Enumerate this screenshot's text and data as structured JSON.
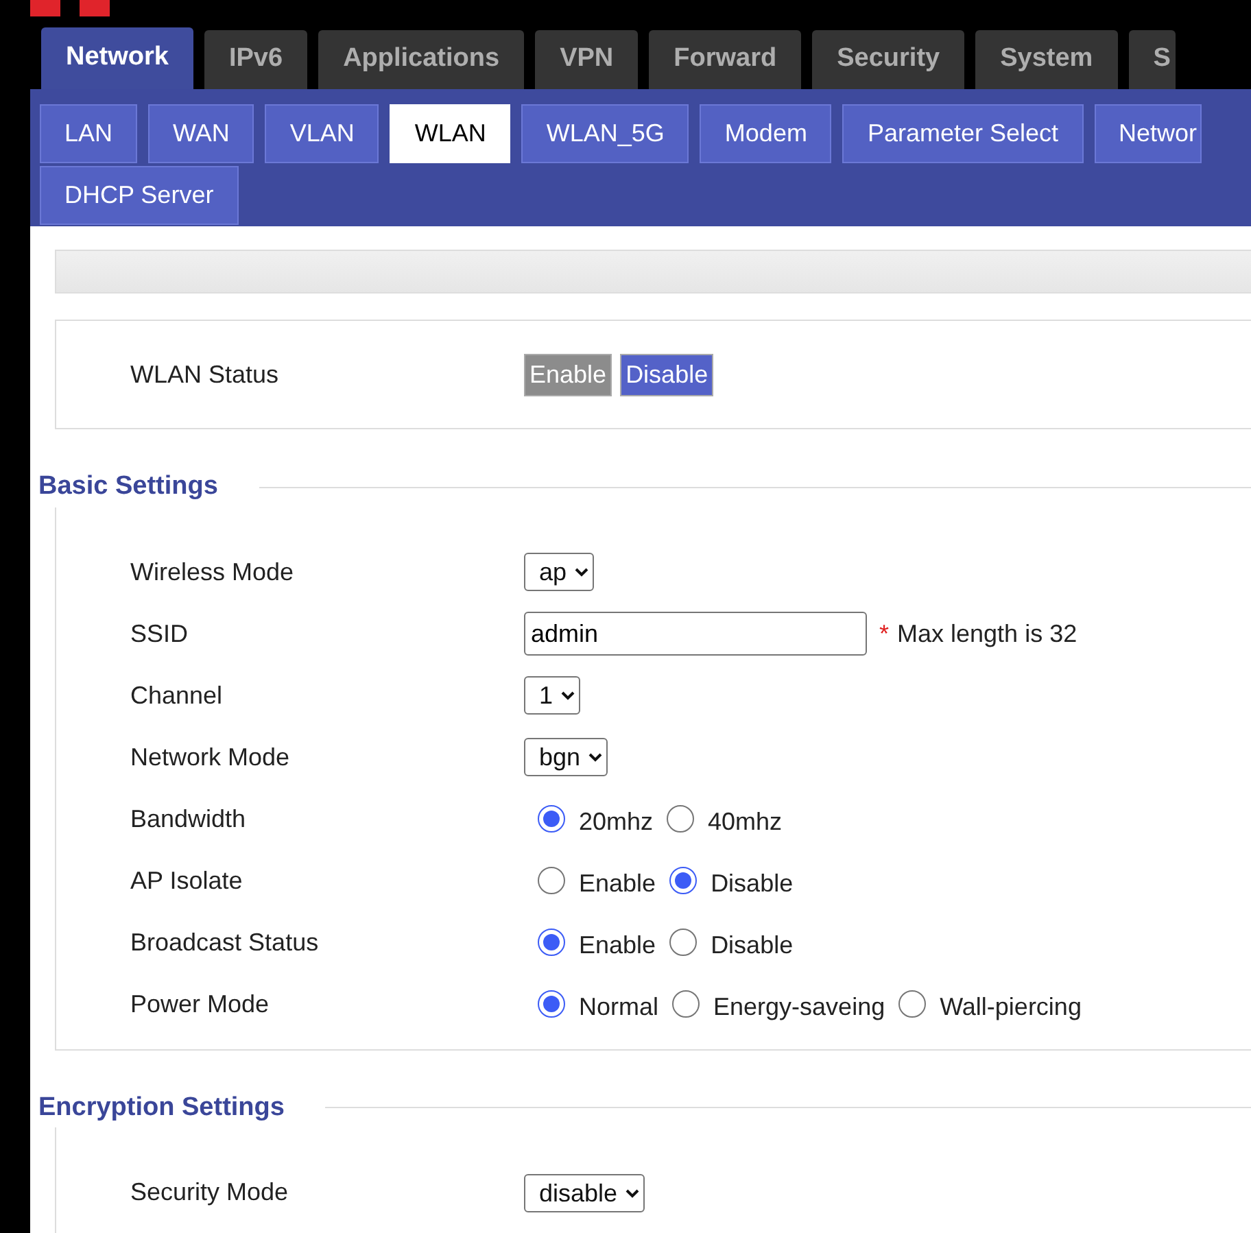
{
  "top_tabs": [
    {
      "label": "Network",
      "selected": true
    },
    {
      "label": "IPv6",
      "selected": false
    },
    {
      "label": "Applications",
      "selected": false
    },
    {
      "label": "VPN",
      "selected": false
    },
    {
      "label": "Forward",
      "selected": false
    },
    {
      "label": "Security",
      "selected": false
    },
    {
      "label": "System",
      "selected": false
    },
    {
      "label": "S",
      "selected": false
    }
  ],
  "sub_tabs": [
    {
      "label": "LAN",
      "selected": false
    },
    {
      "label": "WAN",
      "selected": false
    },
    {
      "label": "VLAN",
      "selected": false
    },
    {
      "label": "WLAN",
      "selected": true
    },
    {
      "label": "WLAN_5G",
      "selected": false
    },
    {
      "label": "Modem",
      "selected": false
    },
    {
      "label": "Parameter Select",
      "selected": false
    },
    {
      "label": "Networ",
      "selected": false
    },
    {
      "label": "DHCP Server",
      "selected": false
    }
  ],
  "wlan_status": {
    "label": "WLAN Status",
    "options": [
      {
        "label": "Enable",
        "selected": false
      },
      {
        "label": "Disable",
        "selected": true
      }
    ]
  },
  "sections": [
    {
      "title": "Basic Settings",
      "rows": [
        {
          "kind": "select",
          "label": "Wireless Mode",
          "value": "ap"
        },
        {
          "kind": "text",
          "label": "SSID",
          "value": "admin",
          "required_mark": "*",
          "note": "Max length is 32"
        },
        {
          "kind": "select",
          "label": "Channel",
          "value": "1"
        },
        {
          "kind": "select",
          "label": "Network Mode",
          "value": "bgn"
        },
        {
          "kind": "radio",
          "label": "Bandwidth",
          "options": [
            {
              "label": "20mhz",
              "selected": true
            },
            {
              "label": "40mhz",
              "selected": false
            }
          ]
        },
        {
          "kind": "radio",
          "label": "AP Isolate",
          "options": [
            {
              "label": "Enable",
              "selected": false
            },
            {
              "label": "Disable",
              "selected": true
            }
          ]
        },
        {
          "kind": "radio",
          "label": "Broadcast Status",
          "options": [
            {
              "label": "Enable",
              "selected": true
            },
            {
              "label": "Disable",
              "selected": false
            }
          ]
        },
        {
          "kind": "radio",
          "label": "Power Mode",
          "options": [
            {
              "label": "Normal",
              "selected": true
            },
            {
              "label": "Energy-saveing",
              "selected": false
            },
            {
              "label": "Wall-piercing",
              "selected": false
            }
          ]
        }
      ]
    },
    {
      "title": "Encryption Settings",
      "rows": [
        {
          "kind": "select",
          "label": "Security Mode",
          "value": "disable"
        }
      ]
    }
  ]
}
